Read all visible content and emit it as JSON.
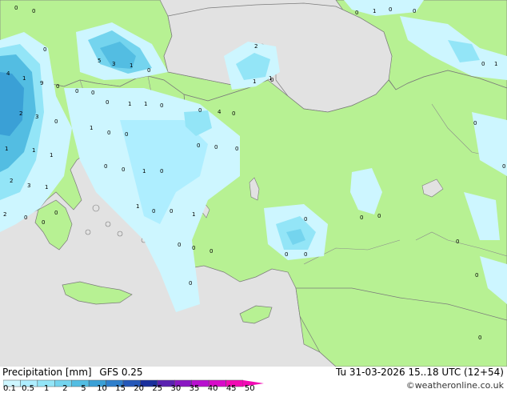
{
  "header": {
    "title": "Precipitation [mm]",
    "model": "GFS 0.25",
    "valid": "Tu 31-03-2026 15..18 UTC (12+54)"
  },
  "credit": "©weatheronline.co.uk",
  "legend": {
    "ticks": [
      "0.1",
      "0.5",
      "1",
      "2",
      "5",
      "10",
      "15",
      "20",
      "25",
      "30",
      "35",
      "40",
      "45",
      "50"
    ],
    "colors": [
      "#cdf6ff",
      "#aeeeff",
      "#93e5f7",
      "#74d4ee",
      "#53bde2",
      "#3aa0d6",
      "#2e7fcc",
      "#2457b8",
      "#1a2f9c",
      "#5a21b0",
      "#8a17c2",
      "#b80fcf",
      "#d80ac9",
      "#f20ab4"
    ]
  },
  "map_colors": {
    "land": "#b7f193",
    "sea": "#e2e2e2",
    "coast": "#7a7a7a"
  },
  "point_values": [
    "0",
    "1",
    "0",
    "0",
    "0",
    "0",
    "0",
    "2",
    "5",
    "3",
    "1",
    "0",
    "4",
    "1",
    "9",
    "0",
    "0",
    "0",
    "0",
    "1",
    "1",
    "0",
    "0",
    "4",
    "3",
    "2",
    "0",
    "1",
    "0",
    "0",
    "1",
    "1",
    "1",
    "1",
    "0",
    "0",
    "0",
    "0",
    "0",
    "0",
    "2",
    "3",
    "1",
    "0",
    "0",
    "1",
    "1",
    "0",
    "2",
    "0",
    "0",
    "0",
    "0",
    "0",
    "0",
    "0",
    "0",
    "0",
    "0",
    "0",
    "0",
    "0",
    "0",
    "0",
    "1",
    "0",
    "1",
    "0",
    "1",
    "0",
    "0"
  ]
}
